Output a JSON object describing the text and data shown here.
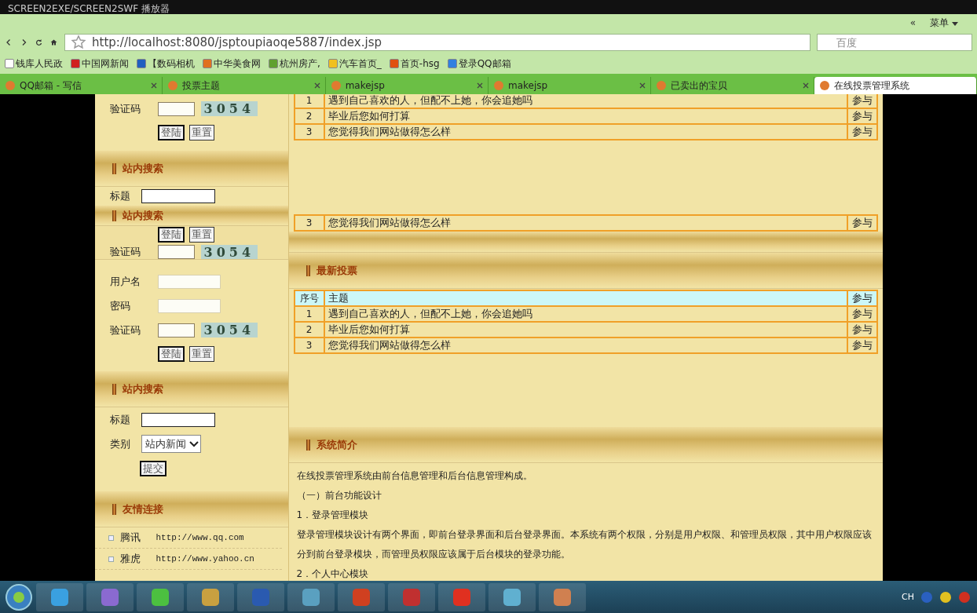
{
  "titlebar": {
    "title": "SCREEN2EXE/SCREEN2SWF 播放器"
  },
  "browser": {
    "back": "«",
    "menu": "菜单",
    "address": "http://localhost:8080/jsptoupiaoqe5887/index.jsp",
    "search_placeholder": "百度",
    "bookmarks": [
      {
        "label": "钱库人民政",
        "color": "#ffffff"
      },
      {
        "label": "中国网新闻",
        "color": "#d02020"
      },
      {
        "label": "【数码相机",
        "color": "#2060c0"
      },
      {
        "label": "中华美食网",
        "color": "#e07020"
      },
      {
        "label": "杭州房产,",
        "color": "#60a030"
      },
      {
        "label": "汽车首页_",
        "color": "#f0c020"
      },
      {
        "label": "首页-hsg",
        "color": "#e05010"
      },
      {
        "label": "登录QQ邮箱",
        "color": "#3080e0"
      }
    ],
    "tabs": [
      {
        "label": "QQ邮箱 - 写信",
        "selected": false
      },
      {
        "label": "投票主题",
        "selected": false
      },
      {
        "label": "makejsp",
        "selected": false
      },
      {
        "label": "makejsp",
        "selected": false
      },
      {
        "label": "已卖出的宝贝",
        "selected": false
      },
      {
        "label": "在线投票管理系统",
        "selected": true
      }
    ]
  },
  "sidebar": {
    "login_tail": {
      "captcha_label": "验证码",
      "captcha": "3054",
      "buttons": [
        "登陆",
        "重置"
      ]
    },
    "search_top": {
      "title": "站内搜索",
      "field_label": "标题"
    },
    "ghost": {
      "title": "站内搜索",
      "buttons": [
        "登陆",
        "重置"
      ],
      "captcha_label": "验证码",
      "captcha": "3054"
    },
    "login": {
      "fields": [
        {
          "label": "用户名",
          "kind": "text"
        },
        {
          "label": "密码",
          "kind": "text"
        },
        {
          "label": "验证码",
          "kind": "captcha",
          "captcha": "3054"
        }
      ],
      "buttons": [
        "登陆",
        "重置"
      ]
    },
    "search": {
      "title": "站内搜索",
      "field_label": "标题",
      "category_label": "类别",
      "category": "站内新闻",
      "submit": "提交"
    },
    "links": {
      "title": "友情连接",
      "items": [
        {
          "name": "腾讯",
          "url": "http://www.qq.com"
        },
        {
          "name": "雅虎",
          "url": "http://www.yahoo.cn"
        }
      ]
    }
  },
  "main": {
    "top_table": {
      "rows": [
        [
          "1",
          "遇到自己喜欢的人，但配不上她，你会追她吗",
          "参与"
        ],
        [
          "2",
          "毕业后您如何打算",
          "参与"
        ],
        [
          "3",
          "您觉得我们网站做得怎么样",
          "参与"
        ]
      ]
    },
    "ghost_row": [
      "3",
      "您觉得我们网站做得怎么样",
      "参与"
    ],
    "votes": {
      "title": "最新投票",
      "columns": [
        "序号",
        "主题",
        "参与"
      ],
      "rows": [
        [
          "1",
          "遇到自己喜欢的人，但配不上她，你会追她吗",
          "参与"
        ],
        [
          "2",
          "毕业后您如何打算",
          "参与"
        ],
        [
          "3",
          "您觉得我们网站做得怎么样",
          "参与"
        ]
      ]
    },
    "intro": {
      "title": "系统简介",
      "paragraphs": [
        "在线投票管理系统由前台信息管理和后台信息管理构成。",
        "（一）前台功能设计",
        "1．登录管理模块",
        "登录管理模块设计有两个界面，即前台登录界面和后台登录界面。本系统有两个权限，分别是用户权限、和管理员权限，其中用户权限应该分到前台登录模块，而管理员权限应该属于后台模块的登录功能。",
        "2．个人中心模块"
      ]
    }
  },
  "taskbar": {
    "language": "CH"
  }
}
